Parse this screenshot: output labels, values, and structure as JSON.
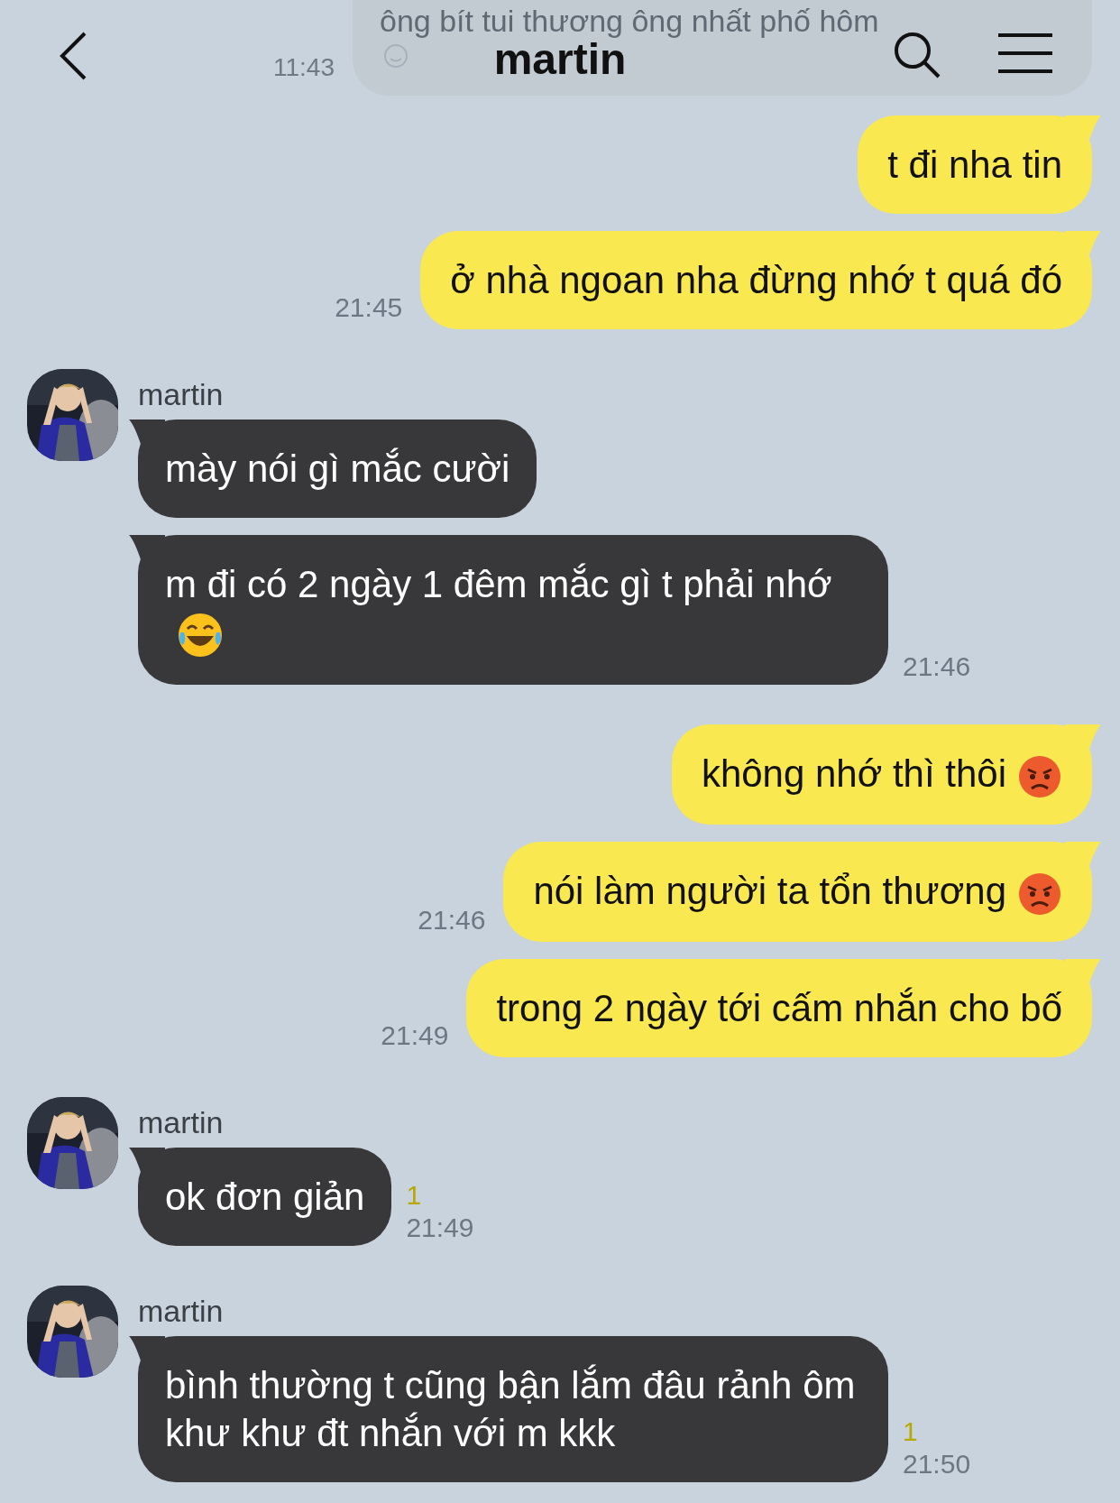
{
  "header": {
    "title": "martin"
  },
  "faded_message": {
    "text": "ông bít tui thương ông nhất phố hôm",
    "time": "11:43"
  },
  "messages": [
    {
      "kind": "sent",
      "text": "t đi nha tin"
    },
    {
      "kind": "sent",
      "text": "ở nhà ngoan nha đừng nhớ t quá đó",
      "time": "21:45"
    },
    {
      "kind": "received",
      "sender": "martin",
      "text": "mày nói gì mắc cười"
    },
    {
      "kind": "received",
      "text": "m đi có 2 ngày 1 đêm mắc gì t phải nhớ",
      "emoji": {
        "kind": "laugh"
      },
      "time": "21:46"
    },
    {
      "kind": "sent",
      "text": "không nhớ thì thôi",
      "emoji": {
        "kind": "angry"
      }
    },
    {
      "kind": "sent",
      "text": "nói làm người ta tổn thương",
      "emoji": {
        "kind": "angry"
      },
      "time": "21:46"
    },
    {
      "kind": "sent",
      "text": "trong 2 ngày tới cấm nhắn cho bố",
      "time": "21:49"
    },
    {
      "kind": "received",
      "sender": "martin",
      "text": "ok đơn giản",
      "unread": "1",
      "time": "21:49"
    },
    {
      "kind": "received",
      "sender": "martin",
      "text": "bình thường t cũng bận lắm đâu rảnh ôm khư khư đt nhắn với m kkk",
      "unread": "1",
      "time": "21:50"
    }
  ]
}
